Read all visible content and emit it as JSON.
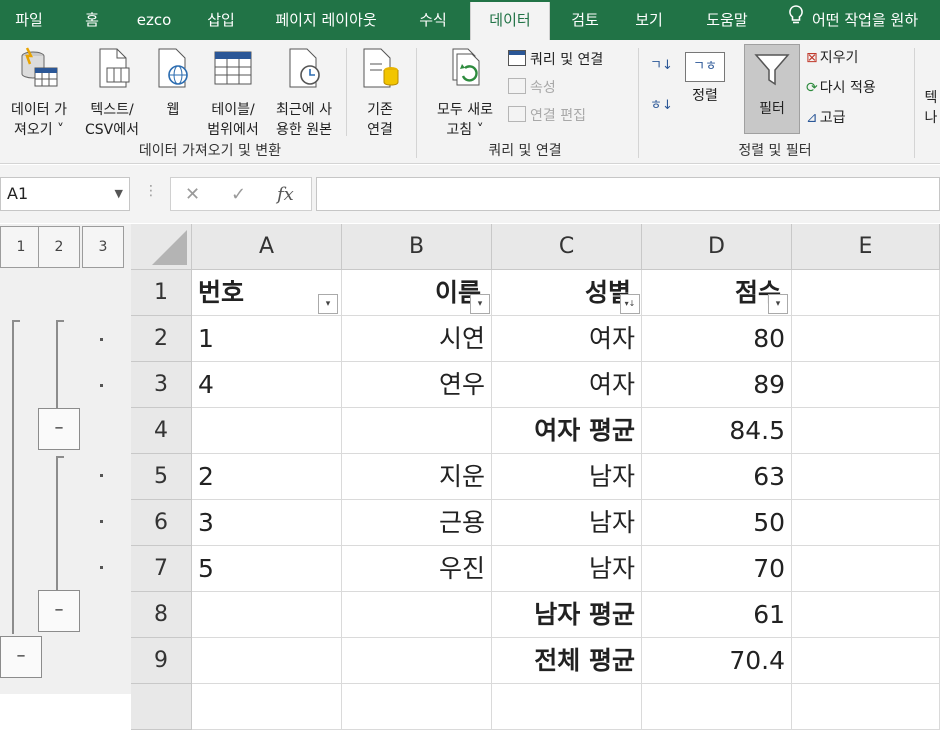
{
  "tabs": [
    {
      "label": "파일",
      "active": false
    },
    {
      "label": "홈",
      "active": false
    },
    {
      "label": "ezco",
      "active": false
    },
    {
      "label": "삽입",
      "active": false
    },
    {
      "label": "페이지 레이아웃",
      "active": false
    },
    {
      "label": "수식",
      "active": false
    },
    {
      "label": "데이터",
      "active": true
    },
    {
      "label": "검토",
      "active": false
    },
    {
      "label": "보기",
      "active": false
    },
    {
      "label": "도움말",
      "active": false
    }
  ],
  "tell_me": "어떤 작업을 원하",
  "ribbon": {
    "get_data": {
      "line1": "데이터 가",
      "line2": "져오기 ˅"
    },
    "from_text": {
      "line1": "텍스트/",
      "line2": "CSV에서"
    },
    "from_web": {
      "line1": "웹"
    },
    "from_table": {
      "line1": "테이블/",
      "line2": "범위에서"
    },
    "recent_sources": {
      "line1": "최근에 사",
      "line2": "용한 원본"
    },
    "existing_connections": {
      "line1": "기존",
      "line2": "연결"
    },
    "group_get_transform": "데이터 가져오기 및 변환",
    "refresh_all": {
      "line1": "모두 새로",
      "line2": "고침 ˅"
    },
    "queries_connections": "쿼리 및 연결",
    "properties": "속성",
    "edit_links": "연결 편집",
    "group_queries": "쿼리 및 연결",
    "sort_asc_icon_text": "ㄱ↓",
    "sort_desc_icon_text": "ㅎ↓",
    "sort_label": "정렬",
    "sort_icon_text": "ㄱㅎ",
    "filter_label": "필터",
    "clear_label": "지우기",
    "reapply_label": "다시 적용",
    "advanced_label": "고급",
    "group_sort_filter": "정렬 및 필터",
    "cut_off_next": {
      "line1": "텍",
      "line2": "나"
    }
  },
  "formula_bar": {
    "name_box": "A1",
    "cancel": "✕",
    "enter": "✓",
    "fx": "fx",
    "formula": ""
  },
  "outline": {
    "levels": [
      "1",
      "2",
      "3"
    ],
    "collapse_symbol": "–"
  },
  "columns": [
    "A",
    "B",
    "C",
    "D",
    "E"
  ],
  "rows": [
    {
      "num": "1",
      "a": "번호",
      "b": "이름",
      "c": "성별",
      "d": "점수",
      "header": true
    },
    {
      "num": "2",
      "a": "1",
      "b": "시연",
      "c": "여자",
      "d": "80",
      "header": false
    },
    {
      "num": "3",
      "a": "4",
      "b": "연우",
      "c": "여자",
      "d": "89",
      "header": false
    },
    {
      "num": "4",
      "a": "",
      "b": "",
      "c": "여자 평균",
      "d": "84.5",
      "header": false,
      "summary": true
    },
    {
      "num": "5",
      "a": "2",
      "b": "지운",
      "c": "남자",
      "d": "63",
      "header": false
    },
    {
      "num": "6",
      "a": "3",
      "b": "근용",
      "c": "남자",
      "d": "50",
      "header": false
    },
    {
      "num": "7",
      "a": "5",
      "b": "우진",
      "c": "남자",
      "d": "70",
      "header": false
    },
    {
      "num": "8",
      "a": "",
      "b": "",
      "c": "남자 평균",
      "d": "61",
      "header": false,
      "summary": true
    },
    {
      "num": "9",
      "a": "",
      "b": "",
      "c": "전체 평균",
      "d": "70.4",
      "header": false,
      "summary": true
    }
  ],
  "filter_buttons": {
    "a": "▾",
    "b": "▾",
    "c": "▾↓",
    "d": "▾"
  },
  "colors": {
    "excel_green": "#217346",
    "ribbon_bg": "#f3f3f3",
    "header_bg": "#e8e8e8",
    "filter_active": "#cfcfcf"
  }
}
